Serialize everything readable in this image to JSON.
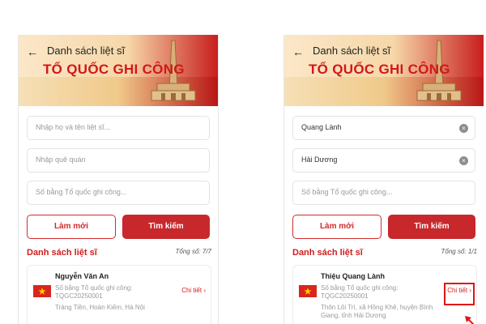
{
  "header": {
    "back_icon": "arrow-left-icon",
    "title": "Danh sách liệt sĩ",
    "banner": "TỔ QUỐC GHI CÔNG"
  },
  "colors": {
    "primary_red": "#c8282b",
    "banner_red": "#d11818",
    "gold": "#f0c98a"
  },
  "left": {
    "name_field": {
      "placeholder": "Nhập họ và tên liệt sĩ..."
    },
    "hometown_field": {
      "placeholder": "Nhập quê quán"
    },
    "certificate_field": {
      "placeholder": "Số bằng Tổ quốc ghi công..."
    },
    "reset_label": "Làm mới",
    "search_label": "Tìm kiếm",
    "list_title": "Danh sách liệt sĩ",
    "total": "Tổng số: 7/7",
    "card": {
      "name": "Nguyễn Văn An",
      "cert_label": "Số bằng Tổ quốc ghi công:",
      "cert_code": "TQGC20250001",
      "address": "Tràng Tiền, Hoàn Kiếm, Hà Nội",
      "detail_label": "Chi tiết ›",
      "flag_icon": "vietnam-flag-icon"
    }
  },
  "right": {
    "name_field": {
      "value": "Quang Lành"
    },
    "hometown_field": {
      "value": "Hải Dương"
    },
    "certificate_field": {
      "placeholder": "Số bằng Tổ quốc ghi công..."
    },
    "clear_icon": "clear-icon",
    "reset_label": "Làm mới",
    "search_label": "Tìm kiếm",
    "list_title": "Danh sách liệt sĩ",
    "total": "Tổng số: 1/1",
    "card": {
      "name": "Thiệu Quang Lành",
      "cert_label": "Số bằng Tổ quốc ghi công:",
      "cert_code": "TQGC20250001",
      "address": "Thôn Lôi Trì, xã Hồng Khê, huyện Bình Giang, tỉnh Hải Dương",
      "detail_label": "Chi tiết ›",
      "flag_icon": "vietnam-flag-icon"
    }
  }
}
